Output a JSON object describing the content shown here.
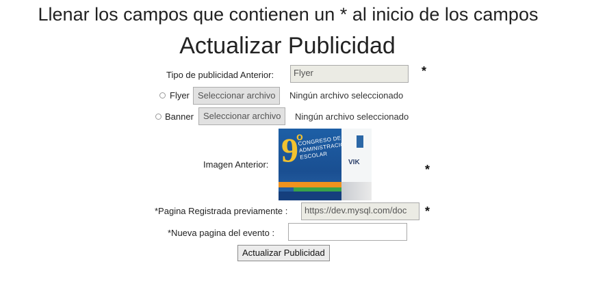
{
  "header": {
    "instructions": "Llenar los campos que contienen un * al inicio de los campos",
    "title": "Actualizar Publicidad"
  },
  "form": {
    "previous_type": {
      "label": "Tipo de publicidad Anterior:",
      "value": "Flyer",
      "required_mark": "*"
    },
    "flyer_option": {
      "label": "Flyer",
      "file_button": "Seleccionar archivo",
      "file_status": "Ningún archivo seleccionado",
      "selected": false
    },
    "banner_option": {
      "label": "Banner",
      "file_button": "Seleccionar archivo",
      "file_status": "Ningún archivo seleccionado",
      "selected": false
    },
    "previous_image": {
      "label": "Imagen Anterior:",
      "required_mark": "*",
      "thumbnail_text": {
        "number": "9",
        "superscript": "o",
        "caption": "CONGRESO DE ADMINISTRACIÓN ESCOLAR",
        "logo": "VIK"
      }
    },
    "previous_page": {
      "label": "*Pagina Registrada previamente :",
      "value": "https://dev.mysql.com/doc",
      "required_mark": "*"
    },
    "new_page": {
      "label": "*Nueva pagina del evento :",
      "value": ""
    },
    "submit_label": "Actualizar Publicidad"
  },
  "colors": {
    "readonly_bg": "#ebebe4",
    "button_bg": "#e1e1e1",
    "text": "#222222"
  }
}
